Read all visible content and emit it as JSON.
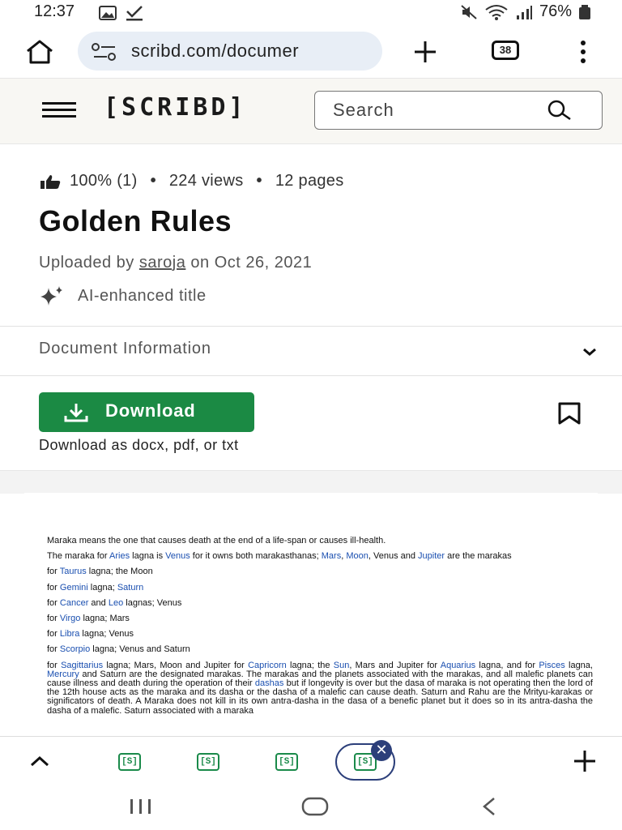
{
  "status_bar": {
    "time": "12:37",
    "battery": "76%"
  },
  "browser": {
    "url": "scribd.com/documer",
    "tab_count": "38"
  },
  "header": {
    "logo": "[SCRIBD]",
    "search_placeholder": "Search"
  },
  "doc_meta": {
    "rating": "100% (1)",
    "views": "224 views",
    "pages": "12 pages",
    "title": "Golden Rules",
    "uploaded_prefix": "Uploaded by",
    "uploader": "saroja",
    "uploaded_date": "on Oct 26, 2021",
    "ai_label": "AI-enhanced title",
    "doc_info_label": "Document Information",
    "download_label": "Download",
    "download_note": "Download as docx, pdf, or txt"
  },
  "document": {
    "line1": "Maraka means the one that causes death at the end of a life-span or causes ill-health.",
    "p2_a": "The maraka for ",
    "p2_aries": "Aries",
    "p2_b": " lagna is ",
    "p2_venus": "Venus",
    "p2_c": " for it owns both marakasthanas; ",
    "p2_mars": "Mars",
    "p2_d": ", ",
    "p2_moon": "Moon",
    "p2_e": ", Venus and ",
    "p2_jupiter": "Jupiter",
    "p2_f": " are the marakas",
    "for": "for ",
    "taurus": "Taurus",
    "taurus_rest": " lagna; the Moon",
    "gemini": "Gemini",
    "gemini_mid": " lagna; ",
    "gemini_saturn": "Saturn",
    "cancer": "Cancer",
    "cancer_mid": " and ",
    "leo": "Leo",
    "leo_rest": " lagnas; Venus",
    "virgo": "Virgo",
    "virgo_rest": " lagna; Mars",
    "libra": "Libra",
    "libra_rest": " lagna; Venus",
    "scorpio": "Scorpio",
    "scorpio_rest": " lagna; Venus and Saturn",
    "sagittarius": "Sagittarius",
    "sag_rest": " lagna; Mars, Moon and Jupiter for ",
    "capricorn": "Capricorn",
    "cap_rest": " lagna; the ",
    "sun": "Sun",
    "sun_rest": ", Mars and Jupiter for ",
    "aquarius": "Aquarius",
    "aq_rest": " lagna, and for ",
    "pisces": "Pisces",
    "pisces_rest": " lagna, ",
    "mercury": "Mercury",
    "long_a": " and Saturn are the designated marakas. The marakas and the planets associated with the marakas, and all malefic planets can cause illness and death during the operation of their ",
    "dashas": "dashas",
    "long_b": " but if longevity is over but the dasa of maraka is not operating then the lord of the 12th house acts as the maraka and its dasha or the dasha of a malefic can cause death. Saturn and Rahu are the Mrityu-karakas or significators of death. A Maraka does not kill in its own antra-dasha in the dasa of a benefic planet but it does so in its antra-dasha the dasha of a malefic. Saturn associated with a maraka"
  }
}
